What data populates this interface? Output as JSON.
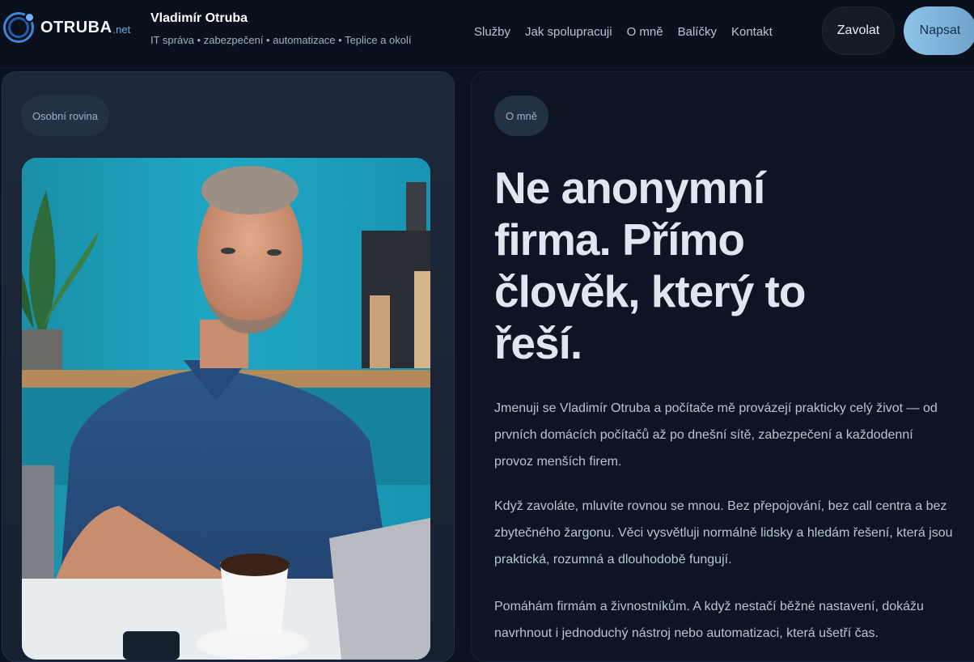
{
  "header": {
    "logo_text": "OTRUBA",
    "logo_suffix": ".net",
    "brand_name": "Vladimír Otruba",
    "brand_tagline": "IT správa • zabezpečení • automatizace • Teplice a okolí",
    "nav": [
      "Služby",
      "Jak spolupracuji",
      "O mně",
      "Balíčky",
      "Kontakt"
    ],
    "call_label": "Zavolat",
    "write_label": "Napsat"
  },
  "left": {
    "pill": "Osobní rovina"
  },
  "right": {
    "pill": "O mně",
    "headline": "Ne anonymní firma. Přímo člověk, který to řeší.",
    "paragraphs": [
      "Jmenuji se Vladimír Otruba a počítače mě provázejí prakticky celý život — od prvních domácích počítačů až po dnešní sítě, zabezpečení a každodenní provoz menších firem.",
      "Když zavoláte, mluvíte rovnou se mnou. Bez přepojování, bez call centra a bez zbytečného žargonu. Věci vysvětluji normálně lidsky a hledám řešení, která jsou praktická, rozumná a dlouhodobě fungují.",
      "Pomáhám firmám a živnostníkům. A když nestačí běžné nastavení, dokážu navrhnout i jednoduchý nástroj nebo automatizaci, která ušetří čas."
    ]
  },
  "colors": {
    "background": "#0b1220",
    "accent": "#8ec3e8",
    "brand_blue": "#3f86d6"
  }
}
